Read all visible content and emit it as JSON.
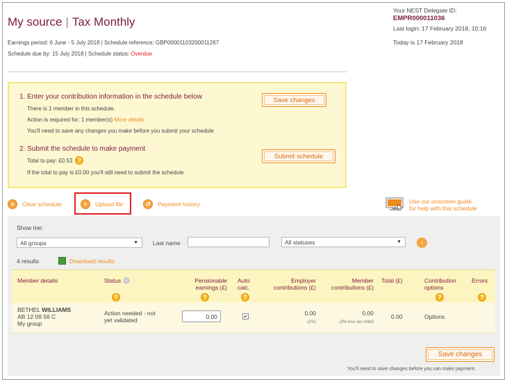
{
  "header": {
    "title_main": "My source",
    "title_separator": "|",
    "title_sub": "Tax Monthly",
    "earnings_period": "Earnings period: 6 June - 5 July 2018 | Schedule reference: GBP00001103200011267",
    "schedule_due": "Schedule due by: 15 July 2018 | Schedule status: ",
    "schedule_status": "Overdue"
  },
  "account": {
    "delegate_label": "Your NEST Delegate ID:",
    "delegate_id": "EMPR000011036",
    "last_login": "Last login: 17 February 2018, 10:16",
    "today": "Today is 17 February 2018"
  },
  "step1": {
    "heading": "1. Enter your contribution information in the schedule below",
    "members": "There is 1 member in this schedule.",
    "action_required": "Action is required for: 1 member(s)",
    "more_details": "More details",
    "save_note": "You'll need to save any changes you make before you submit your schedule",
    "button": "Save changes"
  },
  "step2": {
    "heading": "2. Submit the schedule to make payment",
    "total_to_pay": "Total to pay: £0.53",
    "zero_note": "If the total to pay is £0.00 you'll still need to submit the schedule",
    "button": "Submit schedule"
  },
  "actions": {
    "clear": "Clear schedule",
    "upload": "Upload file",
    "history": "Payment history",
    "guide_line1": "Use our onscreen guide",
    "guide_line2": "for help with this schedule"
  },
  "filters": {
    "show_me": "Show me:",
    "group_select": "All groups",
    "last_name_label": "Last name",
    "last_name_value": "",
    "status_select": "All statuses"
  },
  "results": {
    "count": "4 results",
    "download": "Download results"
  },
  "table": {
    "headers": {
      "member": "Member details",
      "status": "Status",
      "pensionable_line1": "Pensionable",
      "pensionable_line2": "earnings (£)",
      "auto_line1": "Auto",
      "auto_line2": "calc.",
      "employer_line1": "Employer",
      "employer_line2": "contributions (£)",
      "member_line1": "Member",
      "member_line2": "contributions (£)",
      "total": "Total (£)",
      "options_line1": "Contribution",
      "options_line2": "options",
      "errors": "Errors"
    },
    "rows": [
      {
        "first_name": "BETHEL",
        "last_name": "WILLIAMS",
        "ni_number": "AB 12 09 56 C",
        "group": "My group",
        "status_line1": "Action needed - not",
        "status_line2": "yet validated",
        "pensionable": "0.00",
        "auto_calc": true,
        "employer": "0.00",
        "employer_note": "(2%)",
        "member": "0.00",
        "member_note": "(3% less tax relief)",
        "total": "0.00",
        "options": "Options"
      }
    ]
  },
  "footer": {
    "button": "Save changes",
    "note": "You'll need to save changes before you can make payment."
  },
  "colors": {
    "brand": "#7a1a3c",
    "accent": "#f08a1c",
    "alert": "#e0201a",
    "panel": "#efefed",
    "highlight_bg": "#fdf8d2"
  }
}
